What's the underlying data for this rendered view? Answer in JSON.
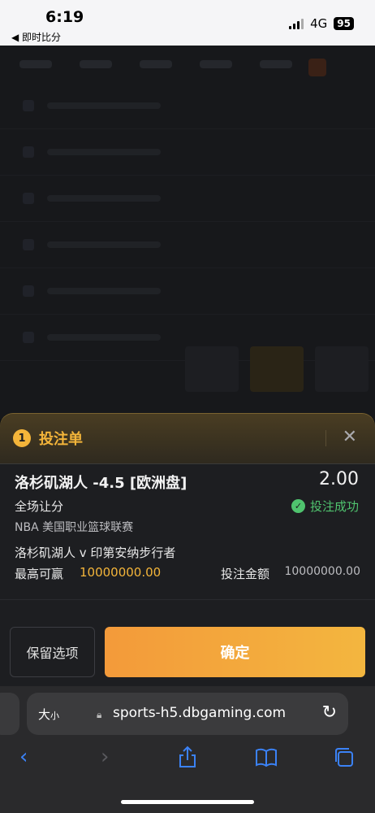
{
  "status_bar": {
    "time": "6:19",
    "back_label": "◀ 即时比分",
    "network": "4G",
    "battery": "95"
  },
  "bet_slip": {
    "count": "1",
    "title": "投注单",
    "selection": "洛杉矶湖人 -4.5 [欧洲盘]",
    "odds": "2.00",
    "market": "全场让分",
    "status": "投注成功",
    "league": "NBA 美国职业篮球联赛",
    "match": "洛杉矶湖人 v 印第安纳步行者",
    "max_win_label": "最高可赢",
    "max_win_value": "10000000.00",
    "stake_label": "投注金额",
    "stake_value": "10000000.00",
    "keep_button": "保留选项",
    "confirm_button": "确定"
  },
  "browser": {
    "text_size_big": "大",
    "text_size_small": "小",
    "url": "sports-h5.dbgaming.com"
  },
  "colors": {
    "accent_gold": "#f4b53a",
    "success_green": "#4fc36e",
    "confirm_gradient_start": "#f39a3a",
    "confirm_gradient_end": "#f3b63f",
    "safari_blue": "#3b82f6"
  },
  "icons": [
    "signal-icon",
    "battery-icon",
    "close-icon",
    "check-circle-icon",
    "lock-icon",
    "reload-icon",
    "back-arrow-icon",
    "forward-arrow-icon",
    "share-icon",
    "bookmarks-icon",
    "tabs-icon"
  ]
}
